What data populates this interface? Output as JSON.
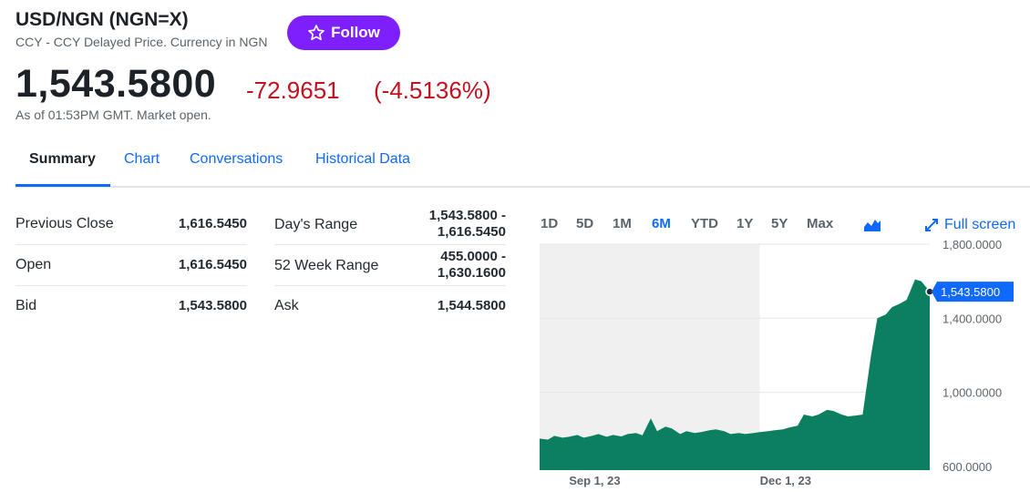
{
  "header": {
    "title": "USD/NGN (NGN=X)",
    "subtitle": "CCY - CCY Delayed Price. Currency in NGN",
    "follow_label": "Follow",
    "price": "1,543.5800",
    "change": "-72.9651",
    "change_pct": "(-4.5136%)",
    "as_of": "As of 01:53PM GMT. Market open."
  },
  "colors": {
    "accent": "#0f69ff",
    "follow_bg": "#7e1fff",
    "down": "#c1121f",
    "chart_fill": "#0b7f5f",
    "badge": "#0f69ff"
  },
  "tabs": [
    {
      "label": "Summary",
      "active": true
    },
    {
      "label": "Chart"
    },
    {
      "label": "Conversations"
    },
    {
      "label": "Historical Data"
    }
  ],
  "stats": {
    "left": [
      {
        "label": "Previous Close",
        "value": "1,616.5450"
      },
      {
        "label": "Open",
        "value": "1,616.5450"
      },
      {
        "label": "Bid",
        "value": "1,543.5800"
      }
    ],
    "right": [
      {
        "label": "Day's Range",
        "value_line1": "1,543.5800 -",
        "value_line2": "1,616.5450"
      },
      {
        "label": "52 Week Range",
        "value_line1": "455.0000 -",
        "value_line2": "1,630.1600"
      },
      {
        "label": "Ask",
        "value_line1": "1,544.5800",
        "value_line2": ""
      }
    ]
  },
  "chart_controls": {
    "ranges": [
      "1D",
      "5D",
      "1M",
      "6M",
      "YTD",
      "1Y",
      "5Y",
      "Max"
    ],
    "active_range": "6M",
    "chart_type_icon": "mountain-chart-icon",
    "fullscreen_label": "Full screen",
    "fullscreen_icon": "expand-icon"
  },
  "chart_data": {
    "type": "area",
    "title": "",
    "xlabel": "",
    "ylabel": "",
    "y_ticks": [
      "1,800.0000",
      "1,400.0000",
      "1,000.0000",
      "600.0000"
    ],
    "ylim": [
      580,
      1800
    ],
    "x_tick_labels": [
      "Sep 1, 23",
      "Dec 1, 23"
    ],
    "current_value_label": "1,543.5800",
    "series": [
      {
        "x": [
          "2023-08-18",
          "2023-08-22",
          "2023-08-25",
          "2023-08-29",
          "2023-09-01",
          "2023-09-05",
          "2023-09-08",
          "2023-09-12",
          "2023-09-15",
          "2023-09-19",
          "2023-09-22",
          "2023-09-26",
          "2023-09-29",
          "2023-10-03",
          "2023-10-06",
          "2023-10-10",
          "2023-10-13",
          "2023-10-17",
          "2023-10-20",
          "2023-10-24",
          "2023-10-27",
          "2023-10-31",
          "2023-11-03",
          "2023-11-07",
          "2023-11-10",
          "2023-11-14",
          "2023-11-17",
          "2023-11-21",
          "2023-11-24",
          "2023-11-28",
          "2023-12-01",
          "2023-12-05",
          "2023-12-08",
          "2023-12-12",
          "2023-12-15",
          "2023-12-19",
          "2023-12-22",
          "2023-12-26",
          "2023-12-29",
          "2024-01-02",
          "2024-01-05",
          "2024-01-09",
          "2024-01-12",
          "2024-01-16",
          "2024-01-19",
          "2024-01-23",
          "2024-01-26",
          "2024-01-30",
          "2024-02-02",
          "2024-02-06",
          "2024-02-09",
          "2024-02-13",
          "2024-02-16",
          "2024-02-20"
        ],
        "values": [
          750,
          745,
          765,
          755,
          760,
          770,
          755,
          765,
          775,
          760,
          770,
          762,
          775,
          780,
          768,
          860,
          790,
          815,
          805,
          775,
          790,
          780,
          785,
          795,
          800,
          790,
          775,
          780,
          775,
          780,
          785,
          790,
          795,
          800,
          810,
          820,
          880,
          870,
          880,
          905,
          900,
          880,
          870,
          875,
          880,
          1200,
          1400,
          1420,
          1460,
          1480,
          1500,
          1610,
          1600,
          1543.58
        ]
      }
    ]
  }
}
